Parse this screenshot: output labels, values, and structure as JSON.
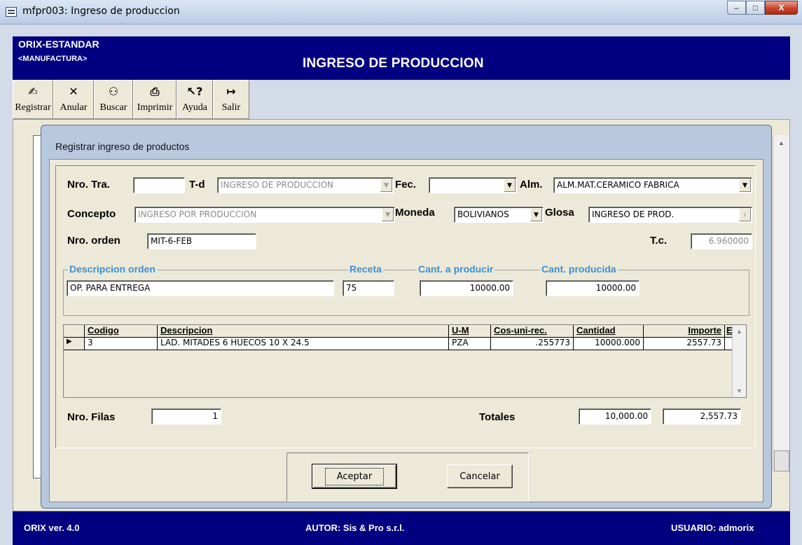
{
  "window": {
    "title": "mfpr003: Ingreso de produccion",
    "min_label": "–",
    "max_label": "□",
    "close_label": "X"
  },
  "header": {
    "brand": "ORIX-ESTANDAR",
    "module": "<MANUFACTURA>",
    "title": "INGRESO DE PRODUCCION"
  },
  "toolbar": [
    {
      "label": "Registrar",
      "icon": "edit-hand-icon",
      "glyph": "✍"
    },
    {
      "label": "Anular",
      "icon": "x-icon",
      "glyph": "✕"
    },
    {
      "label": "Buscar",
      "icon": "binoculars-icon",
      "glyph": "⚇"
    },
    {
      "label": "Imprimir",
      "icon": "printer-icon",
      "glyph": "⎙"
    },
    {
      "label": "Ayuda",
      "icon": "help-cursor-icon",
      "glyph": "↖?"
    },
    {
      "label": "Salir",
      "icon": "exit-door-icon",
      "glyph": "↦"
    }
  ],
  "dialog": {
    "title": "Registrar ingreso de productos",
    "labels": {
      "nro_tra": "Nro. Tra.",
      "td": "T-d",
      "fec": "Fec.",
      "alm": "Alm.",
      "concepto": "Concepto",
      "moneda": "Moneda",
      "glosa": "Glosa",
      "nro_orden": "Nro. orden",
      "tc": "T.c."
    },
    "fields": {
      "nro_tra": "",
      "td": "INGRESO DE PRODUCCION",
      "fec": "",
      "alm": "ALM.MAT.CERAMICO FABRICA",
      "concepto": "INGRESO POR PRODUCCION",
      "moneda": "BOLIVIANOS",
      "glosa": "INGRESO DE PROD.",
      "nro_orden": "MIT-6-FEB",
      "tc": "6.960000"
    },
    "order": {
      "desc_label": "Descripcion orden",
      "receta_label": "Receta",
      "cant_prod_label": "Cant. a producir",
      "cant_producida_label": "Cant. producida",
      "desc": "OP. PARA ENTREGA",
      "receta": "75",
      "cant_prod": "10000.00",
      "cant_producida": "10000.00"
    },
    "grid": {
      "columns": [
        "Codigo",
        "Descripcion",
        "U-M",
        "Cos-uni-rec.",
        "Cantidad",
        "Importe",
        "E"
      ],
      "rows": [
        {
          "codigo": "3",
          "descripcion": "LAD. MITADES 6 HUECOS 10 X 24.5",
          "um": "PZA",
          "cos": ".255773",
          "cantidad": "10000.000",
          "importe": "2557.73",
          "e": ""
        }
      ]
    },
    "footer": {
      "nro_filas_label": "Nro. Filas",
      "nro_filas": "1",
      "totales_label": "Totales",
      "total_cantidad": "10,000.00",
      "total_importe": "2,557.73"
    },
    "buttons": {
      "accept": "Aceptar",
      "cancel": "Cancelar"
    }
  },
  "status": {
    "version": "ORIX ver. 4.0",
    "author": "AUTOR: Sis & Pro s.r.l.",
    "user": "USUARIO: admorix"
  }
}
